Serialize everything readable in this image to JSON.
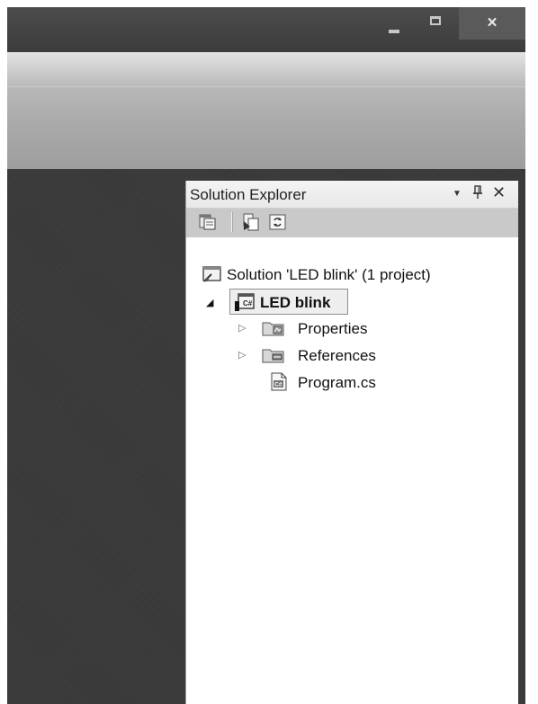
{
  "window": {
    "close_glyph": "×"
  },
  "solution_explorer": {
    "title": "Solution Explorer",
    "header_icons": [
      "dropdown-arrow-icon",
      "pin-icon",
      "close-icon"
    ],
    "toolbar_icons": [
      "properties-icon",
      "show-all-files-icon",
      "refresh-icon"
    ],
    "tree": {
      "solution": {
        "label": "Solution 'LED blink' (1 project)",
        "icon": "solution-icon"
      },
      "project": {
        "label": "LED blink",
        "icon": "csharp-project-icon",
        "expanded": true,
        "selected": true
      },
      "children": [
        {
          "label": "Properties",
          "icon": "properties-folder-icon",
          "expandable": true
        },
        {
          "label": "References",
          "icon": "references-folder-icon",
          "expandable": true
        },
        {
          "label": "Program.cs",
          "icon": "csharp-file-icon",
          "expandable": false
        }
      ]
    }
  },
  "colors": {
    "dark_background": "#3a3a3a",
    "toolbar_gradient_top": "#e4e4e4",
    "toolbar_gradient_bottom": "#9e9e9e",
    "panel_background": "#ffffff",
    "selection_border": "#8f8f8f"
  }
}
